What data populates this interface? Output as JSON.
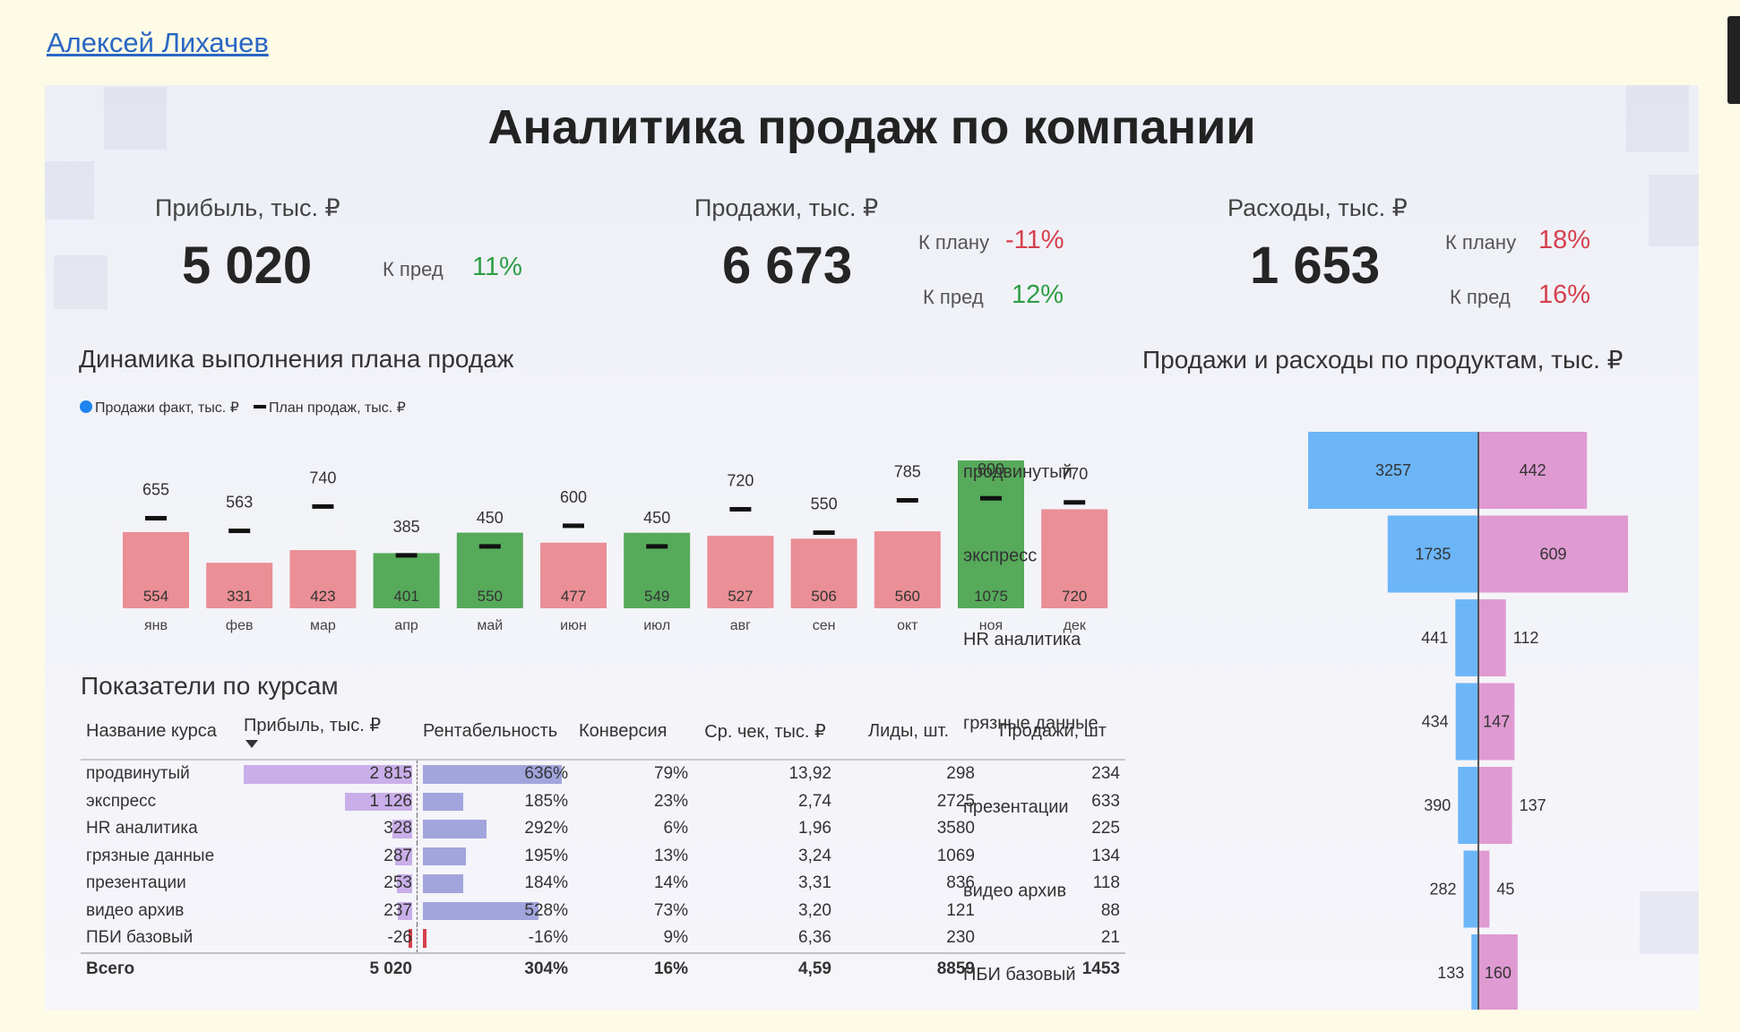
{
  "author": "Алексей Лихачев",
  "dashboard": {
    "title": "Аналитика продаж по компании",
    "kpis": {
      "profit": {
        "label": "Прибыль, тыс. ₽",
        "value": "5 020",
        "prev_label": "К пред",
        "prev_value": "11%"
      },
      "sales": {
        "label": "Продажи, тыс. ₽",
        "value": "6 673",
        "plan_label": "К плану",
        "plan_value": "-11%",
        "prev_label": "К пред",
        "prev_value": "12%"
      },
      "expenses": {
        "label": "Расходы, тыс. ₽",
        "value": "1 653",
        "plan_label": "К плану",
        "plan_value": "18%",
        "prev_label": "К пред",
        "prev_value": "16%"
      }
    },
    "sections": {
      "dynamics": "Динамика выполнения плана продаж",
      "courses": "Показатели по курсам",
      "products": "Продажи и расходы по продуктам, тыс. ₽"
    },
    "colors": {
      "fact_above": "#56aa5a",
      "fact_below": "#ea8f95",
      "plan": "#111111",
      "legend_dot": "#1f84ef",
      "sales_bar": "#6cb6f8",
      "expense_bar": "#df9ad2",
      "profit_bar": "#c9aee9",
      "rent_bar": "#a2a5dc",
      "neg_bar": "#d6404d"
    }
  },
  "chart_data": [
    {
      "type": "bar",
      "title": "Динамика выполнения плана продаж",
      "legend_position": "top-left",
      "categories": [
        "янв",
        "фев",
        "мар",
        "апр",
        "май",
        "июн",
        "июл",
        "авг",
        "сен",
        "окт",
        "ноя",
        "дек"
      ],
      "series": [
        {
          "name": "Продажи факт, тыс. ₽",
          "values": [
            554,
            331,
            423,
            401,
            550,
            477,
            549,
            527,
            506,
            560,
            1075,
            720
          ]
        },
        {
          "name": "План продаж, тыс. ₽",
          "values": [
            655,
            563,
            740,
            385,
            450,
            600,
            450,
            720,
            550,
            785,
            800,
            770
          ]
        }
      ],
      "ylim": [
        0,
        1075
      ]
    },
    {
      "type": "bar",
      "title": "Продажи и расходы по продуктам, тыс. ₽",
      "categories": [
        "продвинутый",
        "экспресс",
        "HR аналитика",
        "грязные данные",
        "презентации",
        "видео архив",
        "ПБИ базовый"
      ],
      "series": [
        {
          "values": [
            3257,
            1735,
            441,
            434,
            390,
            282,
            133
          ]
        },
        {
          "values": [
            442,
            609,
            112,
            147,
            137,
            45,
            160
          ]
        }
      ]
    },
    {
      "type": "table",
      "title": "Показатели по курсам",
      "columns": [
        "Название курса",
        "Прибыль, тыс. ₽",
        "Рентабельность",
        "Конверсия",
        "Ср. чек, тыс. ₽",
        "Лиды, шт.",
        "Продажи, шт"
      ],
      "rows": [
        {
          "name": "продвинутый",
          "profit": "2 815",
          "profit_num": 2815,
          "rent": "636%",
          "rent_num": 636,
          "conv": "79%",
          "check": "13,92",
          "leads": "298",
          "sales": "234"
        },
        {
          "name": "экспресс",
          "profit": "1 126",
          "profit_num": 1126,
          "rent": "185%",
          "rent_num": 185,
          "conv": "23%",
          "check": "2,74",
          "leads": "2725",
          "sales": "633"
        },
        {
          "name": "HR аналитика",
          "profit": "328",
          "profit_num": 328,
          "rent": "292%",
          "rent_num": 292,
          "conv": "6%",
          "check": "1,96",
          "leads": "3580",
          "sales": "225"
        },
        {
          "name": "грязные данные",
          "profit": "287",
          "profit_num": 287,
          "rent": "195%",
          "rent_num": 195,
          "conv": "13%",
          "check": "3,24",
          "leads": "1069",
          "sales": "134"
        },
        {
          "name": "презентации",
          "profit": "253",
          "profit_num": 253,
          "rent": "184%",
          "rent_num": 184,
          "conv": "14%",
          "check": "3,31",
          "leads": "836",
          "sales": "118"
        },
        {
          "name": "видео архив",
          "profit": "237",
          "profit_num": 237,
          "rent": "528%",
          "rent_num": 528,
          "conv": "73%",
          "check": "3,20",
          "leads": "121",
          "sales": "88"
        },
        {
          "name": "ПБИ базовый",
          "profit": "-26",
          "profit_num": -26,
          "rent": "-16%",
          "rent_num": -16,
          "conv": "9%",
          "check": "6,36",
          "leads": "230",
          "sales": "21"
        }
      ],
      "total": {
        "name": "Всего",
        "profit": "5 020",
        "rent": "304%",
        "conv": "16%",
        "check": "4,59",
        "leads": "8859",
        "sales": "1453"
      }
    }
  ]
}
